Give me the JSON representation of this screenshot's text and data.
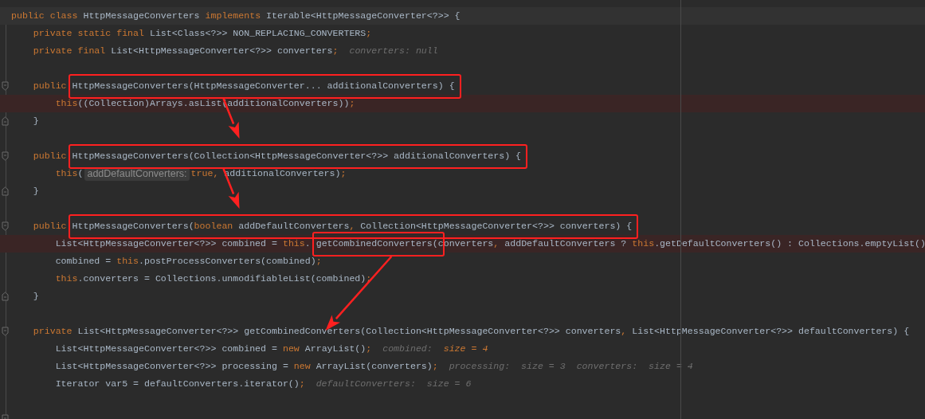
{
  "lines": [
    {
      "kind": "code",
      "current": true,
      "breakpoint": false,
      "tokens": [
        {
          "kind": "kw",
          "text": "public class"
        },
        {
          "kind": "plain",
          "text": " HttpMessageConverters "
        },
        {
          "kind": "kw",
          "text": "implements"
        },
        {
          "kind": "plain",
          "text": " Iterable<HttpMessageConverter<?>> {"
        }
      ],
      "children": [
        {
          "kind": "code",
          "current": false,
          "breakpoint": false,
          "tokens": [
            {
              "kind": "kw",
              "text": "private static final"
            },
            {
              "kind": "plain",
              "text": " List<Class<?>> NON_REPLACING_CONVERTERS"
            },
            {
              "kind": "punct",
              "text": ";"
            }
          ]
        },
        {
          "kind": "code",
          "current": false,
          "breakpoint": false,
          "tokens": [
            {
              "kind": "kw",
              "text": "private final"
            },
            {
              "kind": "plain",
              "text": " List<HttpMessageConverter<?>> converters"
            },
            {
              "kind": "punct",
              "text": ";"
            },
            {
              "kind": "hint",
              "text": "converters: null"
            }
          ]
        },
        {
          "kind": "blank"
        },
        {
          "kind": "block_start",
          "current": false,
          "breakpoint": false,
          "tokens": [
            {
              "kind": "kw",
              "text": "public"
            },
            {
              "kind": "boxed",
              "tokens": [
                {
                  "kind": "plain",
                  "text": "HttpMessageConverters(HttpMessageConverter... additionalConverters) {"
                }
              ]
            }
          ],
          "children": [
            {
              "kind": "code",
              "current": false,
              "breakpoint": true,
              "tokens": [
                {
                  "kind": "kw",
                  "text": "this"
                },
                {
                  "kind": "plain",
                  "text": "((Collection)Arrays.asList(additionalConverters))"
                },
                {
                  "kind": "punct",
                  "text": ";"
                }
              ]
            }
          ]
        },
        {
          "kind": "block_end",
          "current": false,
          "breakpoint": false,
          "tokens": [
            {
              "kind": "plain",
              "text": "}"
            }
          ]
        },
        {
          "kind": "blank"
        },
        {
          "kind": "block_start",
          "current": false,
          "breakpoint": false,
          "tokens": [
            {
              "kind": "kw",
              "text": "public"
            },
            {
              "kind": "boxed",
              "arrow_in": true,
              "tokens": [
                {
                  "kind": "plain",
                  "text": "HttpMessageConverters(Collection<HttpMessageConverter<?>> additionalConverters) {"
                }
              ]
            }
          ],
          "children": [
            {
              "kind": "code",
              "current": false,
              "breakpoint": false,
              "tokens": [
                {
                  "kind": "kw",
                  "text": "this"
                },
                {
                  "kind": "plain",
                  "text": "("
                },
                {
                  "kind": "inlay",
                  "text": "addDefaultConverters:"
                },
                {
                  "kind": "kw",
                  "text": "true"
                },
                {
                  "kind": "punct",
                  "text": ","
                },
                {
                  "kind": "plain",
                  "text": " additionalConverters)"
                },
                {
                  "kind": "punct",
                  "text": ";"
                }
              ]
            }
          ]
        },
        {
          "kind": "block_end",
          "current": false,
          "breakpoint": false,
          "tokens": [
            {
              "kind": "plain",
              "text": "}"
            }
          ]
        },
        {
          "kind": "blank"
        },
        {
          "kind": "block_start",
          "current": false,
          "breakpoint": false,
          "tokens": [
            {
              "kind": "kw",
              "text": "public"
            },
            {
              "kind": "boxed",
              "arrow_in": true,
              "tokens": [
                {
                  "kind": "plain",
                  "text": "HttpMessageConverters("
                },
                {
                  "kind": "kw",
                  "text": "boolean"
                },
                {
                  "kind": "plain",
                  "text": " addDefaultConverters"
                },
                {
                  "kind": "punct",
                  "text": ","
                },
                {
                  "kind": "plain",
                  "text": " Collection<HttpMessageConverter<?>> converters) {"
                }
              ]
            }
          ],
          "children": [
            {
              "kind": "code",
              "current": false,
              "breakpoint": true,
              "tokens": [
                {
                  "kind": "plain",
                  "text": "List<HttpMessageConverter<?>> combined = "
                },
                {
                  "kind": "kw",
                  "text": "this"
                },
                {
                  "kind": "plain",
                  "text": "."
                },
                {
                  "kind": "boxed",
                  "tokens": [
                    {
                      "kind": "plain",
                      "text": "getCombinedConverters("
                    }
                  ]
                },
                {
                  "kind": "plain",
                  "text": "converters"
                },
                {
                  "kind": "punct",
                  "text": ","
                },
                {
                  "kind": "plain",
                  "text": " addDefaultConverters ? "
                },
                {
                  "kind": "kw",
                  "text": "this"
                },
                {
                  "kind": "plain",
                  "text": ".getDefaultConverters() : Collections.emptyList()"
                }
              ]
            },
            {
              "kind": "code",
              "current": false,
              "breakpoint": false,
              "tokens": [
                {
                  "kind": "plain",
                  "text": "combined = "
                },
                {
                  "kind": "kw",
                  "text": "this"
                },
                {
                  "kind": "plain",
                  "text": ".postProcessConverters(combined)"
                },
                {
                  "kind": "punct",
                  "text": ";"
                }
              ]
            },
            {
              "kind": "code",
              "current": false,
              "breakpoint": false,
              "tokens": [
                {
                  "kind": "kw",
                  "text": "this"
                },
                {
                  "kind": "plain",
                  "text": ".converters = Collections.unmodifiableList(combined)"
                },
                {
                  "kind": "punct",
                  "text": ";"
                }
              ]
            }
          ]
        },
        {
          "kind": "block_end",
          "current": false,
          "breakpoint": false,
          "tokens": [
            {
              "kind": "plain",
              "text": "}"
            }
          ]
        },
        {
          "kind": "blank"
        },
        {
          "kind": "block_start",
          "current": false,
          "breakpoint": false,
          "tokens": [
            {
              "kind": "kw",
              "text": "private"
            },
            {
              "kind": "plain",
              "text": " List<HttpMessageConverter<?>> "
            },
            {
              "kind": "target",
              "arrow_in": true,
              "tokens": [
                {
                  "kind": "plain",
                  "text": "getCombinedConverters"
                }
              ]
            },
            {
              "kind": "plain",
              "text": "(Collection<HttpMessageConverter<?>> converters"
            },
            {
              "kind": "punct",
              "text": ","
            },
            {
              "kind": "plain",
              "text": " List<HttpMessageConverter<?>> defaultConverters) {"
            }
          ],
          "children": [
            {
              "kind": "code",
              "current": false,
              "breakpoint": false,
              "tokens": [
                {
                  "kind": "plain",
                  "text": "List<HttpMessageConverter<?>> combined = "
                },
                {
                  "kind": "kw",
                  "text": "new"
                },
                {
                  "kind": "plain",
                  "text": " ArrayList()"
                },
                {
                  "kind": "punct",
                  "text": ";"
                },
                {
                  "kind": "hint",
                  "text": "combined:"
                },
                {
                  "kind": "hint_value",
                  "text": "size = 4"
                }
              ]
            },
            {
              "kind": "code",
              "current": false,
              "breakpoint": false,
              "tokens": [
                {
                  "kind": "plain",
                  "text": "List<HttpMessageConverter<?>> processing = "
                },
                {
                  "kind": "kw",
                  "text": "new"
                },
                {
                  "kind": "plain",
                  "text": " ArrayList(converters)"
                },
                {
                  "kind": "punct",
                  "text": ";"
                },
                {
                  "kind": "hint",
                  "text": "processing:"
                },
                {
                  "kind": "hint",
                  "text": "size = 3"
                },
                {
                  "kind": "hint",
                  "text": "converters:"
                },
                {
                  "kind": "hint",
                  "text": "size = 4"
                }
              ]
            },
            {
              "kind": "code",
              "current": false,
              "breakpoint": false,
              "tokens": [
                {
                  "kind": "plain",
                  "text": "Iterator var5 = defaultConverters.iterator()"
                },
                {
                  "kind": "punct",
                  "text": ";"
                },
                {
                  "kind": "hint",
                  "text": "defaultConverters:"
                },
                {
                  "kind": "hint",
                  "text": "size = 6"
                }
              ]
            },
            {
              "kind": "blank"
            },
            {
              "kind": "block_start",
              "current": false,
              "breakpoint": false
            }
          ]
        }
      ]
    }
  ]
}
